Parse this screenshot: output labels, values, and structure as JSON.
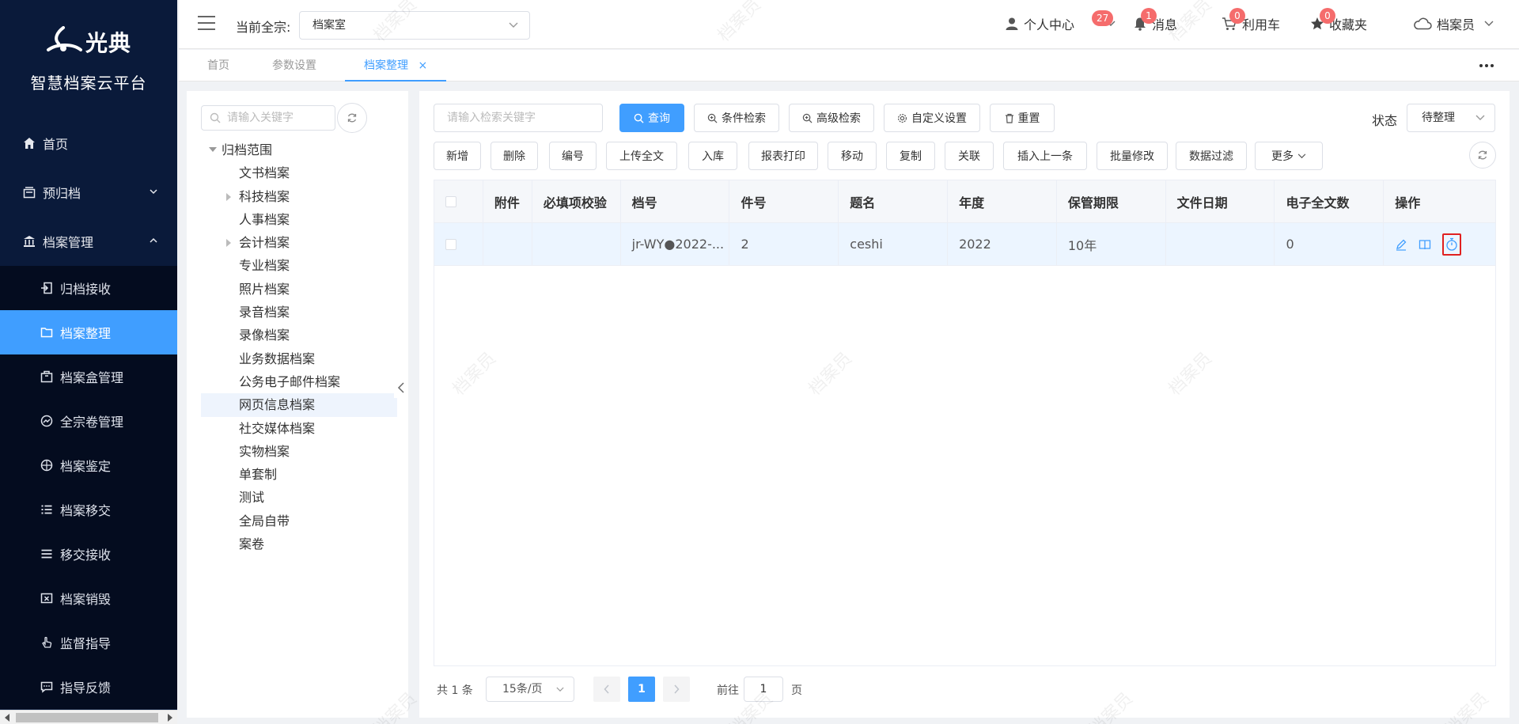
{
  "sidebar": {
    "logo_text": "光典",
    "platform_title": "智慧档案云平台",
    "nav": [
      {
        "label": "首页",
        "icon": "home-icon"
      },
      {
        "label": "预归档",
        "icon": "tray-icon"
      },
      {
        "label": "档案管理",
        "icon": "bank-icon"
      }
    ],
    "subnav": [
      {
        "label": "归档接收",
        "icon": "archive-receive-icon"
      },
      {
        "label": "档案整理",
        "icon": "folder-icon"
      },
      {
        "label": "档案盒管理",
        "icon": "box-icon"
      },
      {
        "label": "全宗卷管理",
        "icon": "dashboard-icon"
      },
      {
        "label": "档案鉴定",
        "icon": "compass-icon"
      },
      {
        "label": "档案移交",
        "icon": "list-icon"
      },
      {
        "label": "移交接收",
        "icon": "list-icon"
      },
      {
        "label": "档案销毁",
        "icon": "destroy-icon"
      },
      {
        "label": "监督指导",
        "icon": "hand-icon"
      },
      {
        "label": "指导反馈",
        "icon": "comment-icon"
      }
    ]
  },
  "header": {
    "fonds_label": "当前全宗:",
    "fonds_value": "档案室",
    "user_center": "个人中心",
    "user_center_badge": "27",
    "messages": "消息",
    "messages_badge": "1",
    "cart": "利用车",
    "cart_badge": "0",
    "favorites": "收藏夹",
    "favorites_badge": "0",
    "user": "档案员"
  },
  "tabs": [
    {
      "label": "首页"
    },
    {
      "label": "参数设置"
    },
    {
      "label": "档案整理",
      "close": "×"
    }
  ],
  "tree": {
    "search_placeholder": "请输入关键字",
    "root": "归档范围",
    "children": [
      "文书档案",
      "科技档案",
      "人事档案",
      "会计档案",
      "专业档案",
      "照片档案",
      "录音档案",
      "录像档案",
      "业务数据档案",
      "公务电子邮件档案",
      "网页信息档案",
      "社交媒体档案",
      "实物档案",
      "单套制",
      "测试",
      "全局自带",
      "案卷"
    ],
    "expandable": [
      "科技档案",
      "会计档案"
    ],
    "highlighted": "网页信息档案"
  },
  "toolbar": {
    "search_placeholder": "请输入检索关键字",
    "query": "查询",
    "condition_search": "条件检索",
    "advanced_search": "高级检索",
    "custom_settings": "自定义设置",
    "reset": "重置",
    "status_label": "状态",
    "status_value": "待整理",
    "actions": [
      "新增",
      "删除",
      "编号",
      "上传全文",
      "入库",
      "报表打印",
      "移动",
      "复制",
      "关联",
      "插入上一条",
      "批量修改",
      "数据过滤",
      "更多"
    ]
  },
  "table": {
    "columns": [
      "附件",
      "必填项校验",
      "档号",
      "件号",
      "题名",
      "年度",
      "保管期限",
      "文件日期",
      "电子全文数",
      "操作"
    ],
    "rows": [
      {
        "attachment": "",
        "required_check": "",
        "archive_no": "jr-WY●2022-...",
        "item_no": "2",
        "title": "ceshi",
        "year": "2022",
        "retention": "10年",
        "file_date": "",
        "fulltext_count": "0",
        "ops": [
          "edit-icon",
          "book-icon",
          "stopwatch-icon"
        ]
      }
    ]
  },
  "pagination": {
    "total": "共 1 条",
    "page_size": "15条/页",
    "current_page": "1",
    "goto_label": "前往",
    "goto_value": "1",
    "page_unit": "页"
  },
  "watermark": "档案员",
  "colors": {
    "primary": "#409eff",
    "sidebar_bg": "#0a1a3a",
    "badge": "#f56c6c",
    "highlight_border": "#e02020"
  }
}
